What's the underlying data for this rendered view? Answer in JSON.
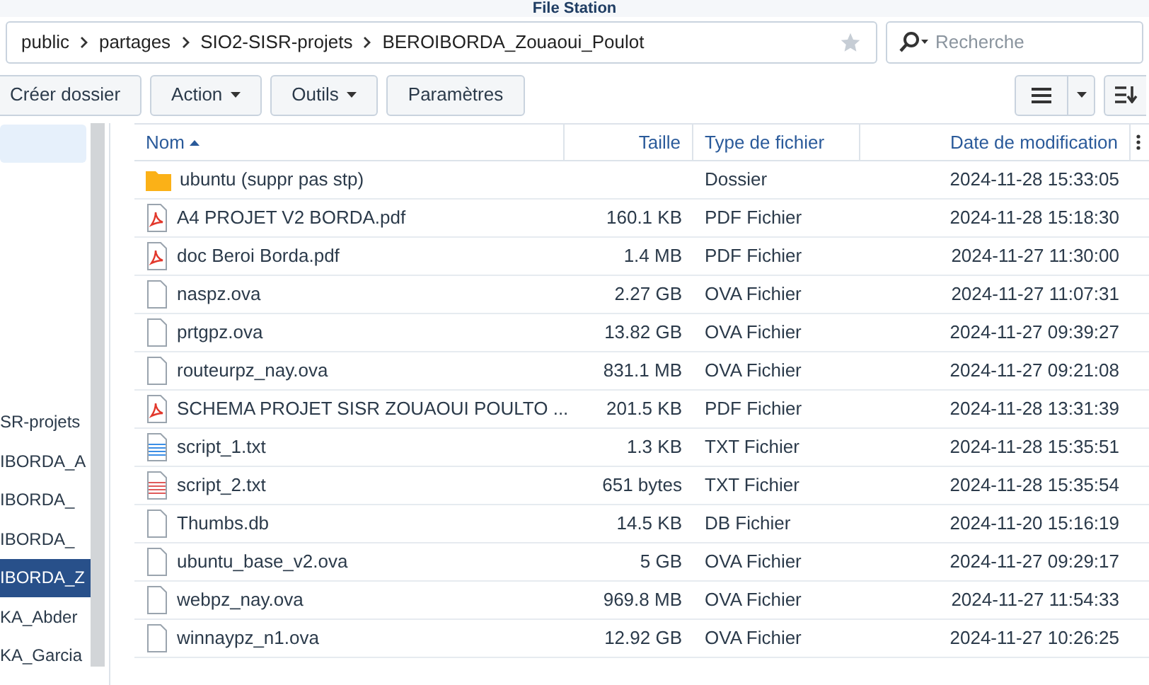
{
  "window": {
    "title": "File Station"
  },
  "breadcrumb": [
    "public",
    "partages",
    "SIO2-SISR-projets",
    "BEROIBORDA_Zouaoui_Poulot"
  ],
  "search": {
    "placeholder": "Recherche"
  },
  "toolbar": [
    {
      "label": "Créer dossier",
      "dropdown": false
    },
    {
      "label": "Action",
      "dropdown": true
    },
    {
      "label": "Outils",
      "dropdown": true
    },
    {
      "label": "Paramètres",
      "dropdown": false
    }
  ],
  "sidebar": {
    "items": [
      {
        "label": "SR-projets",
        "selected": false
      },
      {
        "label": "IBORDA_A",
        "selected": false
      },
      {
        "label": "IBORDA_",
        "selected": false
      },
      {
        "label": "IBORDA_",
        "selected": false
      },
      {
        "label": "IBORDA_Z",
        "selected": true
      },
      {
        "label": "KA_Abder",
        "selected": false
      },
      {
        "label": "KA_Garcia",
        "selected": false
      }
    ]
  },
  "table": {
    "columns": [
      "Nom",
      "Taille",
      "Type de fichier",
      "Date de modification"
    ],
    "rows": [
      {
        "kind": "folder",
        "name": "ubuntu (suppr pas stp)",
        "size": "",
        "type": "Dossier",
        "date": "2024-11-28 15:33:05"
      },
      {
        "kind": "pdf",
        "name": "A4 PROJET V2 BORDA.pdf",
        "size": "160.1 KB",
        "type": "PDF Fichier",
        "date": "2024-11-28 15:18:30"
      },
      {
        "kind": "pdf",
        "name": "doc Beroi Borda.pdf",
        "size": "1.4 MB",
        "type": "PDF Fichier",
        "date": "2024-11-27 11:30:00"
      },
      {
        "kind": "file",
        "name": "naspz.ova",
        "size": "2.27 GB",
        "type": "OVA Fichier",
        "date": "2024-11-27 11:07:31"
      },
      {
        "kind": "file",
        "name": "prtgpz.ova",
        "size": "13.82 GB",
        "type": "OVA Fichier",
        "date": "2024-11-27 09:39:27"
      },
      {
        "kind": "file",
        "name": "routeurpz_nay.ova",
        "size": "831.1 MB",
        "type": "OVA Fichier",
        "date": "2024-11-27 09:21:08"
      },
      {
        "kind": "pdf",
        "name": "SCHEMA PROJET SISR ZOUAOUI POULTO ...",
        "size": "201.5 KB",
        "type": "PDF Fichier",
        "date": "2024-11-28 13:31:39"
      },
      {
        "kind": "text_blue",
        "name": "script_1.txt",
        "size": "1.3 KB",
        "type": "TXT Fichier",
        "date": "2024-11-28 15:35:51"
      },
      {
        "kind": "text_red",
        "name": "script_2.txt",
        "size": "651 bytes",
        "type": "TXT Fichier",
        "date": "2024-11-28 15:35:54"
      },
      {
        "kind": "file",
        "name": "Thumbs.db",
        "size": "14.5 KB",
        "type": "DB Fichier",
        "date": "2024-11-20 15:16:19"
      },
      {
        "kind": "file",
        "name": "ubuntu_base_v2.ova",
        "size": "5 GB",
        "type": "OVA Fichier",
        "date": "2024-11-27 09:29:17"
      },
      {
        "kind": "file",
        "name": "webpz_nay.ova",
        "size": "969.8 MB",
        "type": "OVA Fichier",
        "date": "2024-11-27 11:54:33"
      },
      {
        "kind": "file",
        "name": "winnaypz_n1.ova",
        "size": "12.92 GB",
        "type": "OVA Fichier",
        "date": "2024-11-27 10:26:25"
      }
    ]
  }
}
